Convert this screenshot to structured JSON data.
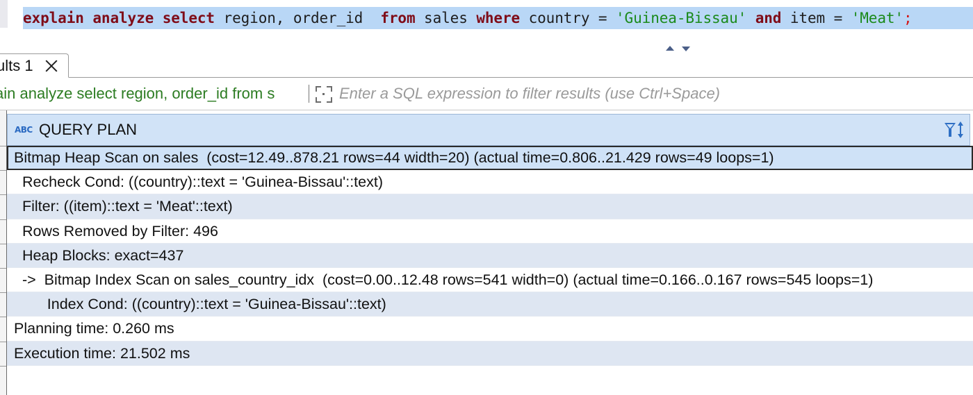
{
  "editor": {
    "sql_tokens": [
      {
        "t": "explain",
        "c": "kw"
      },
      {
        "t": " ",
        "c": ""
      },
      {
        "t": "analyze",
        "c": "kw"
      },
      {
        "t": " ",
        "c": ""
      },
      {
        "t": "select",
        "c": "kw"
      },
      {
        "t": " region, order_id  ",
        "c": ""
      },
      {
        "t": "from",
        "c": "kw"
      },
      {
        "t": " sales ",
        "c": ""
      },
      {
        "t": "where",
        "c": "kw"
      },
      {
        "t": " country = ",
        "c": ""
      },
      {
        "t": "'Guinea-Bissau'",
        "c": "str"
      },
      {
        "t": " ",
        "c": ""
      },
      {
        "t": "and",
        "c": "kw"
      },
      {
        "t": " item = ",
        "c": ""
      },
      {
        "t": "'Meat'",
        "c": "str"
      },
      {
        "t": ";",
        "c": "semi"
      }
    ]
  },
  "results_tab": {
    "label": "ults 1"
  },
  "filter_bar": {
    "query_text": "ain analyze select region, order_id from s",
    "placeholder": "Enter a SQL expression to filter results (use Ctrl+Space)"
  },
  "grid": {
    "column_header": "QUERY PLAN",
    "type_badge": "ABC",
    "rows": [
      "Bitmap Heap Scan on sales  (cost=12.49..878.21 rows=44 width=20) (actual time=0.806..21.429 rows=49 loops=1)",
      "  Recheck Cond: ((country)::text = 'Guinea-Bissau'::text)",
      "  Filter: ((item)::text = 'Meat'::text)",
      "  Rows Removed by Filter: 496",
      "  Heap Blocks: exact=437",
      "  ->  Bitmap Index Scan on sales_country_idx  (cost=0.00..12.48 rows=541 width=0) (actual time=0.166..0.167 rows=545 loops=1)",
      "        Index Cond: ((country)::text = 'Guinea-Bissau'::text)",
      "Planning time: 0.260 ms",
      "Execution time: 21.502 ms"
    ]
  },
  "colors": {
    "selection": "#b9d7f6",
    "keyword": "#7f0c18",
    "string": "#1b8a1b",
    "filter_query": "#2c7c22",
    "header_bg": "#d1e3f7",
    "alt_row": "#dee6f2"
  }
}
